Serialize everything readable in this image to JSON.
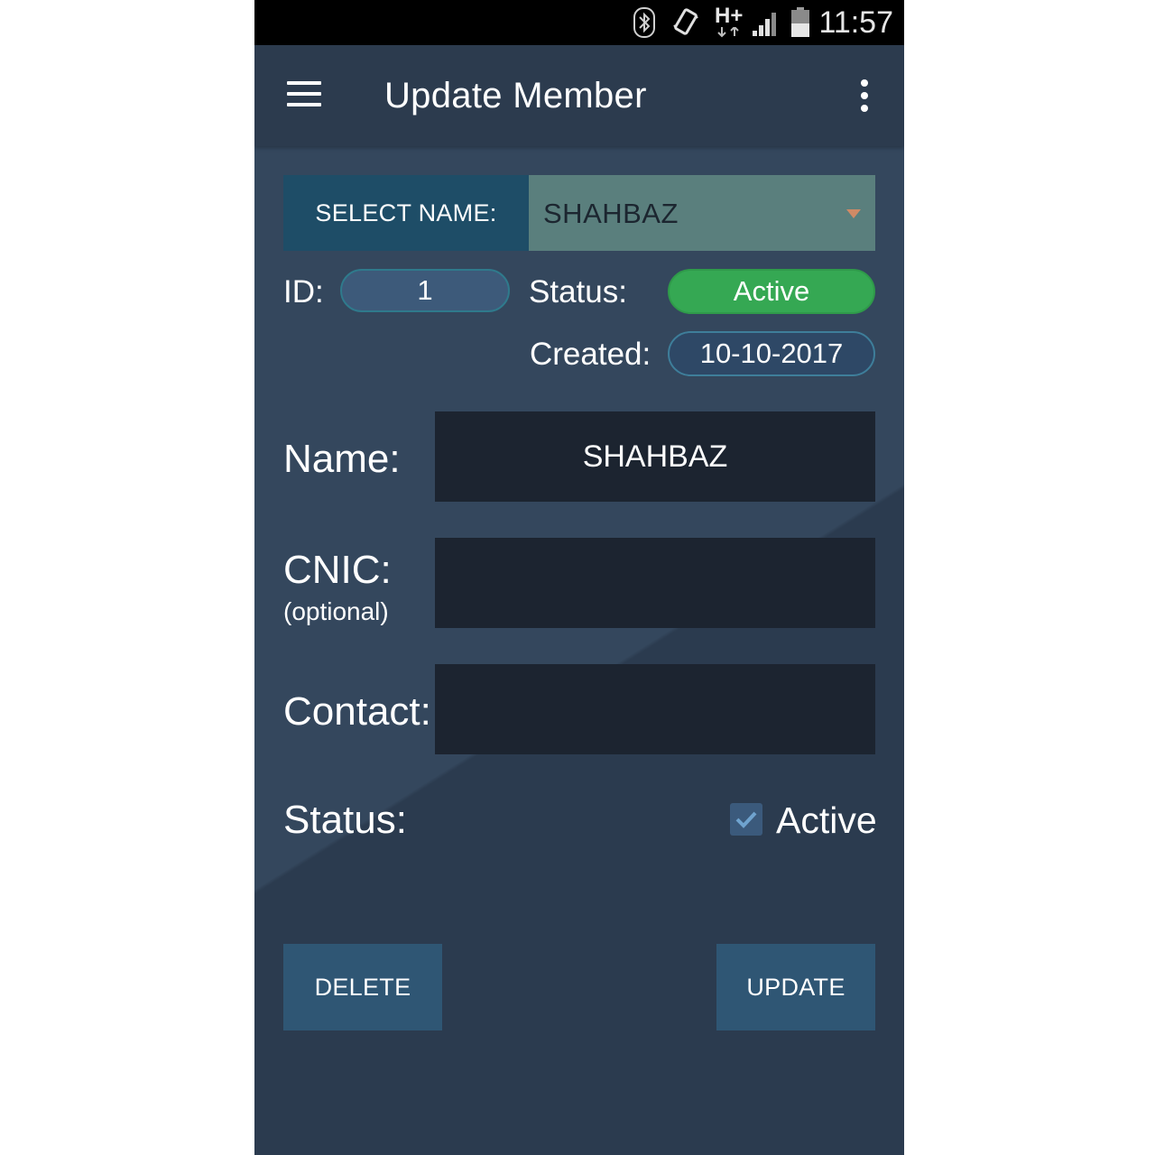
{
  "status_bar": {
    "time": "11:57",
    "network_label": "H+",
    "icons": [
      "bluetooth-icon",
      "vibrate-icon",
      "network-h-plus-icon",
      "signal-icon",
      "battery-icon"
    ]
  },
  "toolbar": {
    "title": "Update Member",
    "menu_icon": "hamburger-menu-icon",
    "overflow_icon": "more-vert-icon"
  },
  "select": {
    "label": "SELECT NAME:",
    "value": "SHAHBAZ"
  },
  "info": {
    "id_label": "ID:",
    "id_value": "1",
    "status_label": "Status:",
    "status_value": "Active",
    "created_label": "Created:",
    "created_value": "10-10-2017"
  },
  "form": {
    "name_label": "Name:",
    "name_value": "SHAHBAZ",
    "cnic_label": "CNIC:",
    "cnic_sublabel": "(optional)",
    "cnic_value": "",
    "contact_label": "Contact:",
    "contact_value": "",
    "status_label": "Status:",
    "active_checkbox_label": "Active",
    "active_checked": true
  },
  "buttons": {
    "delete": "DELETE",
    "update": "UPDATE"
  },
  "colors": {
    "background": "#34475d",
    "toolbar": "#2c3b4e",
    "select_label_bg": "#1e4d67",
    "select_bg": "#5a7f7d",
    "status_active": "#35a853",
    "field_bg": "#1c2430",
    "button_bg": "#2f5674"
  }
}
